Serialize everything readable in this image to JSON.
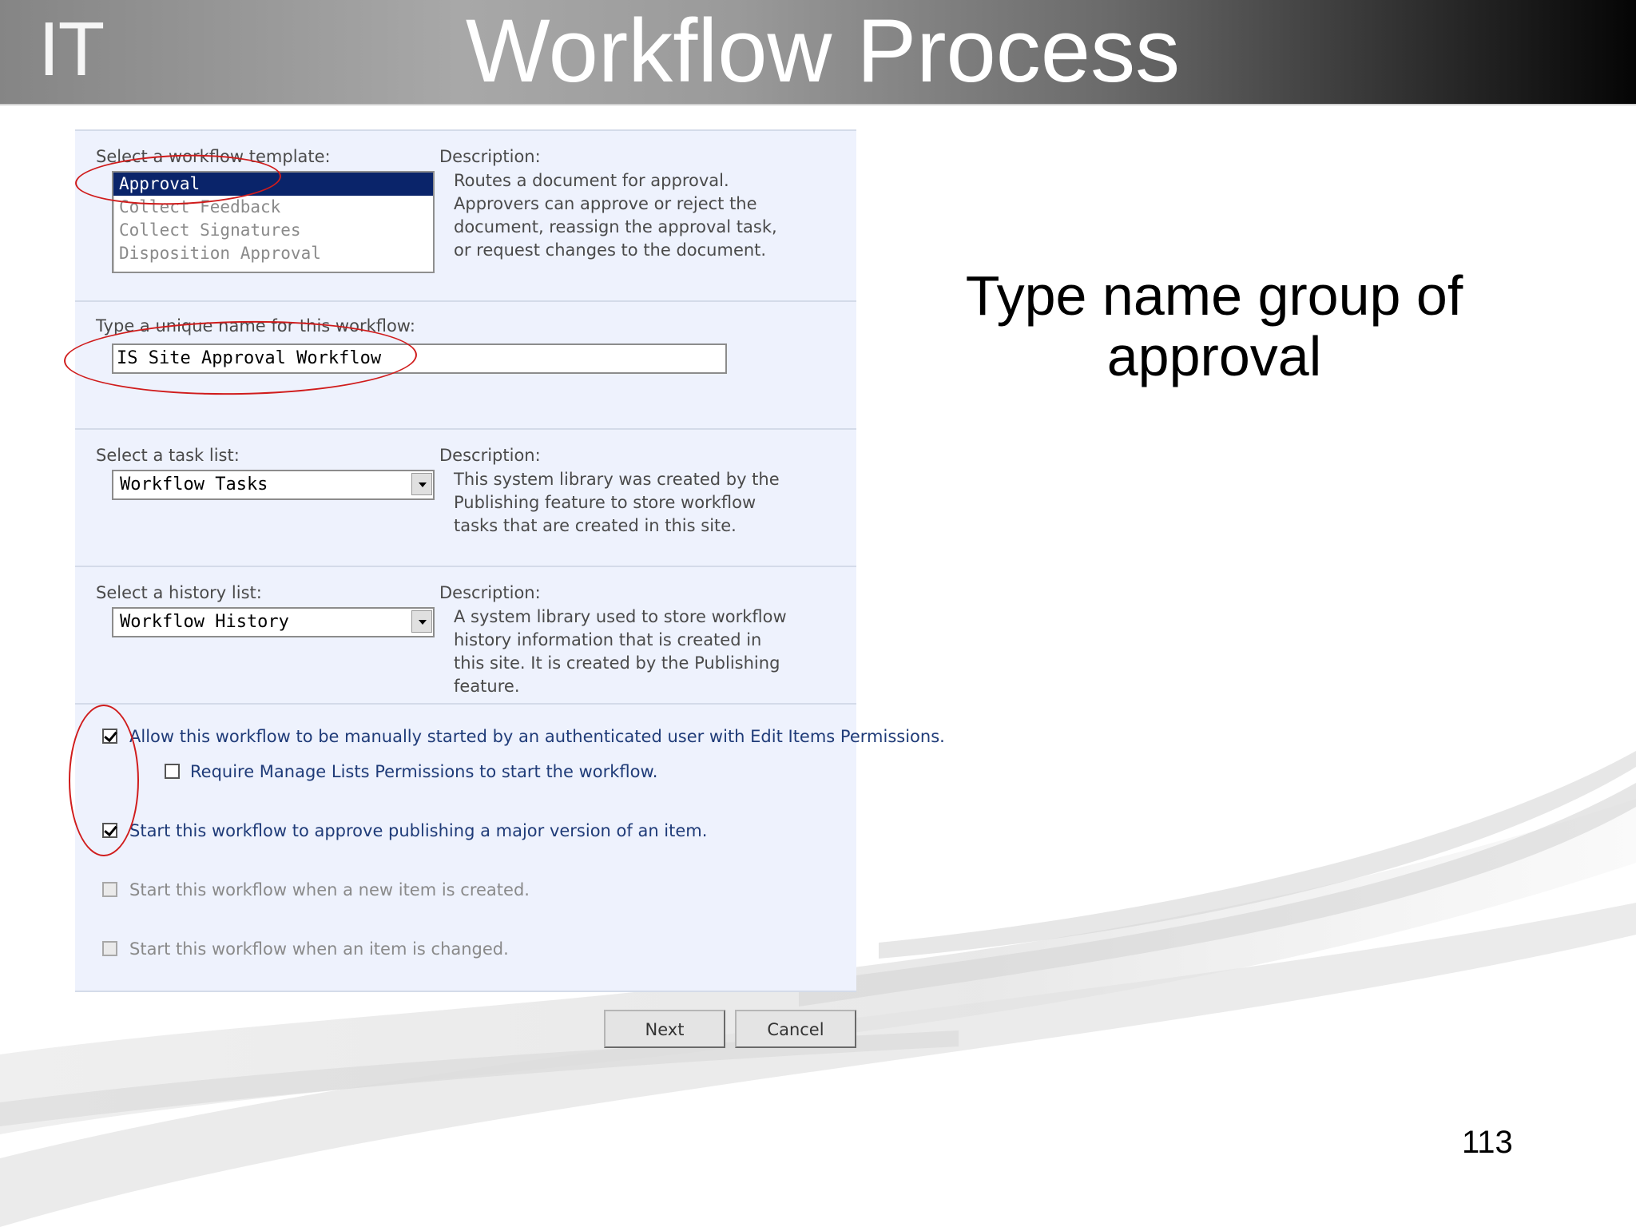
{
  "slide": {
    "logo_text": "IT",
    "title": "Workflow Process",
    "note": "Type name group of approval",
    "page_number": "113"
  },
  "form": {
    "template_section": {
      "label": "Select a workflow template:",
      "options": [
        "Approval",
        "Collect Feedback",
        "Collect Signatures",
        "Disposition Approval"
      ],
      "selected": "Approval",
      "description_label": "Description:",
      "description": "Routes a document for approval. Approvers can approve or reject the document, reassign the approval task, or request changes to the document."
    },
    "name_section": {
      "label": "Type a unique name for this workflow:",
      "value": "IS Site Approval Workflow"
    },
    "task_section": {
      "label": "Select a task list:",
      "selected": "Workflow Tasks",
      "description_label": "Description:",
      "description": "This system library was created by the Publishing feature to store workflow tasks that are created in this site."
    },
    "history_section": {
      "label": "Select a history list:",
      "selected": "Workflow History",
      "description_label": "Description:",
      "description": "A system library used to store workflow history information that is created in this site. It is created by the Publishing feature."
    },
    "options_section": {
      "manual_start": {
        "label": "Allow this workflow to be manually started by an authenticated user with Edit Items Permissions.",
        "checked": true
      },
      "require_manage": {
        "label": "Require Manage Lists Permissions to start the workflow.",
        "checked": false
      },
      "approve_major": {
        "label": "Start this workflow to approve publishing a major version of an item.",
        "checked": true
      },
      "on_create": {
        "label": "Start this workflow when a new item is created.",
        "checked": false,
        "disabled": true
      },
      "on_change": {
        "label": "Start this workflow when an item is changed.",
        "checked": false,
        "disabled": true
      }
    },
    "buttons": {
      "next": "Next",
      "cancel": "Cancel"
    }
  },
  "colors": {
    "highlight_circle": "#d01c1c",
    "selection": "#0a246a",
    "panel_bg": "#eef2fd"
  }
}
